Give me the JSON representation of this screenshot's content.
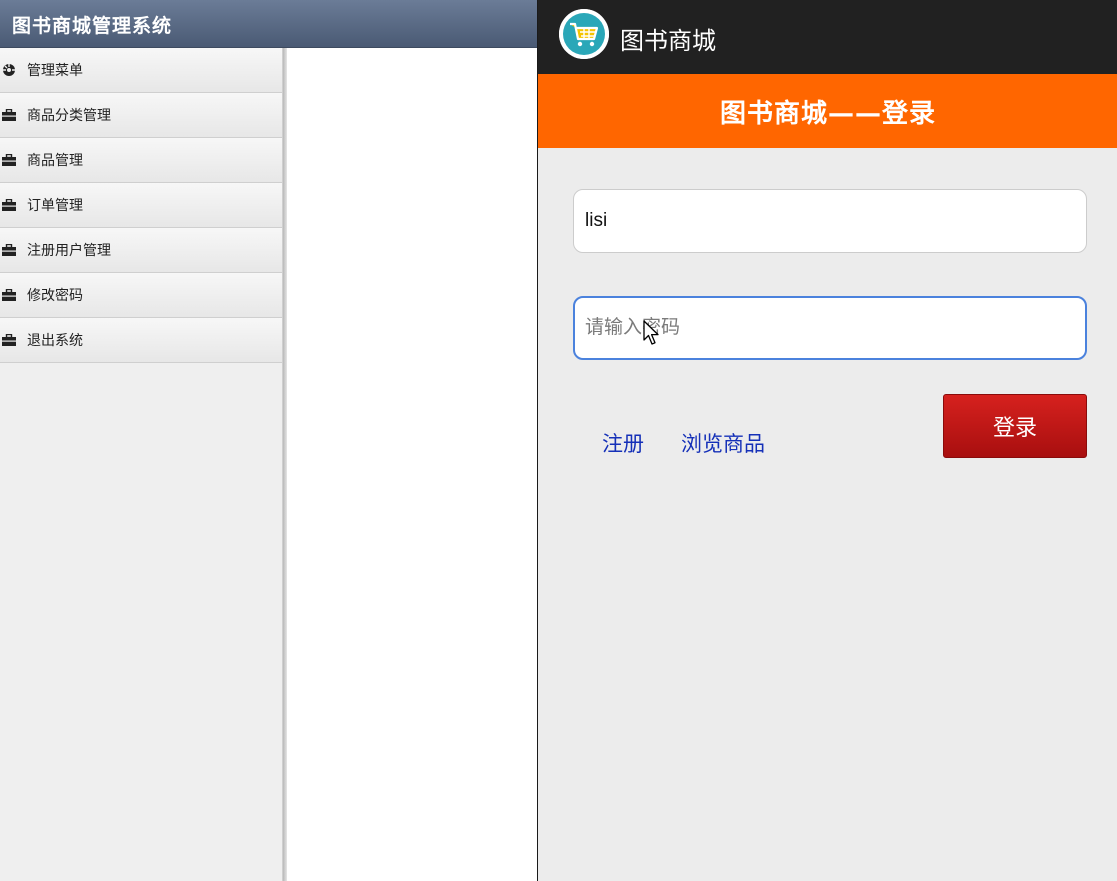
{
  "admin": {
    "title": "图书商城管理系统",
    "menu": [
      {
        "label": "管理菜单",
        "icon": "dashboard-icon"
      },
      {
        "label": "商品分类管理",
        "icon": "briefcase-icon"
      },
      {
        "label": "商品管理",
        "icon": "briefcase-icon"
      },
      {
        "label": "订单管理",
        "icon": "briefcase-icon"
      },
      {
        "label": "注册用户管理",
        "icon": "briefcase-icon"
      },
      {
        "label": "修改密码",
        "icon": "briefcase-icon"
      },
      {
        "label": "退出系统",
        "icon": "briefcase-icon"
      }
    ]
  },
  "app": {
    "title": "图书商城",
    "logo_icon": "shopping-cart-icon",
    "page_header": "图书商城——登录",
    "login": {
      "username_value": "lisi",
      "password_placeholder": "请输入密码",
      "register_label": "注册",
      "browse_label": "浏览商品",
      "login_label": "登录"
    }
  },
  "colors": {
    "admin_header": "#55657f",
    "app_bar": "#212121",
    "orange_header": "#ff6600",
    "login_button": "#c21a18",
    "link": "#1530b8",
    "focus_border": "#4b82dd"
  }
}
